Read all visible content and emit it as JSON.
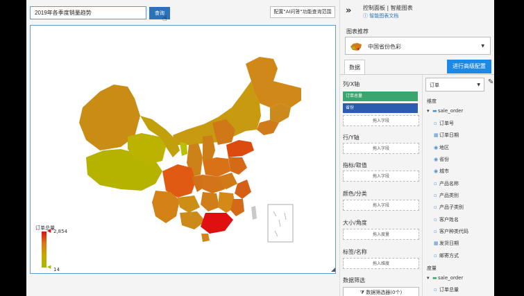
{
  "toolbar": {
    "search_value": "2019年各季度销量趋势",
    "query_label": "查询",
    "config_label": "配置\"AI问答\"功能查询范围"
  },
  "map": {
    "legend_title": "订单总量",
    "legend_max": "2,854",
    "legend_min": "14"
  },
  "panel": {
    "title": "控制面板 | 智能图表",
    "doc_link": "智能图表文档",
    "chart_rec_label": "图表推荐",
    "chart_type": "中国省份色彩",
    "advanced_label": "进行高级配置",
    "tab_data": "数据",
    "x_axis": "列/X轴",
    "x_chip1": "订单总量",
    "x_chip2": "省份",
    "drop_field": "拖入字段",
    "y_axis": "行/Y轴",
    "metric": "指标/取值",
    "color": "颜色/分类",
    "size": "大小/角度",
    "drop_measure": "拖入度量",
    "label": "标签/名称",
    "drop_dimension": "拖入维度",
    "filter": "数据筛选",
    "filter_btn": "数据筛选器(0个)",
    "dataset": "订单",
    "dim_header": "维度",
    "dim_table": "sale_order",
    "dims": [
      "订单号",
      "订单日期",
      "地区",
      "省份",
      "城市",
      "产品名称",
      "产品类别",
      "产品子类别",
      "客户姓名",
      "客户种类代码",
      "发货日期",
      "邮寄方式"
    ],
    "measure_header": "度量",
    "measure_table": "sale_order",
    "measures": [
      "订单总量"
    ]
  },
  "colors": {
    "accent": "#2b73b9",
    "chip_green": "#3aa56e",
    "chip_blue": "#2a5db0"
  }
}
